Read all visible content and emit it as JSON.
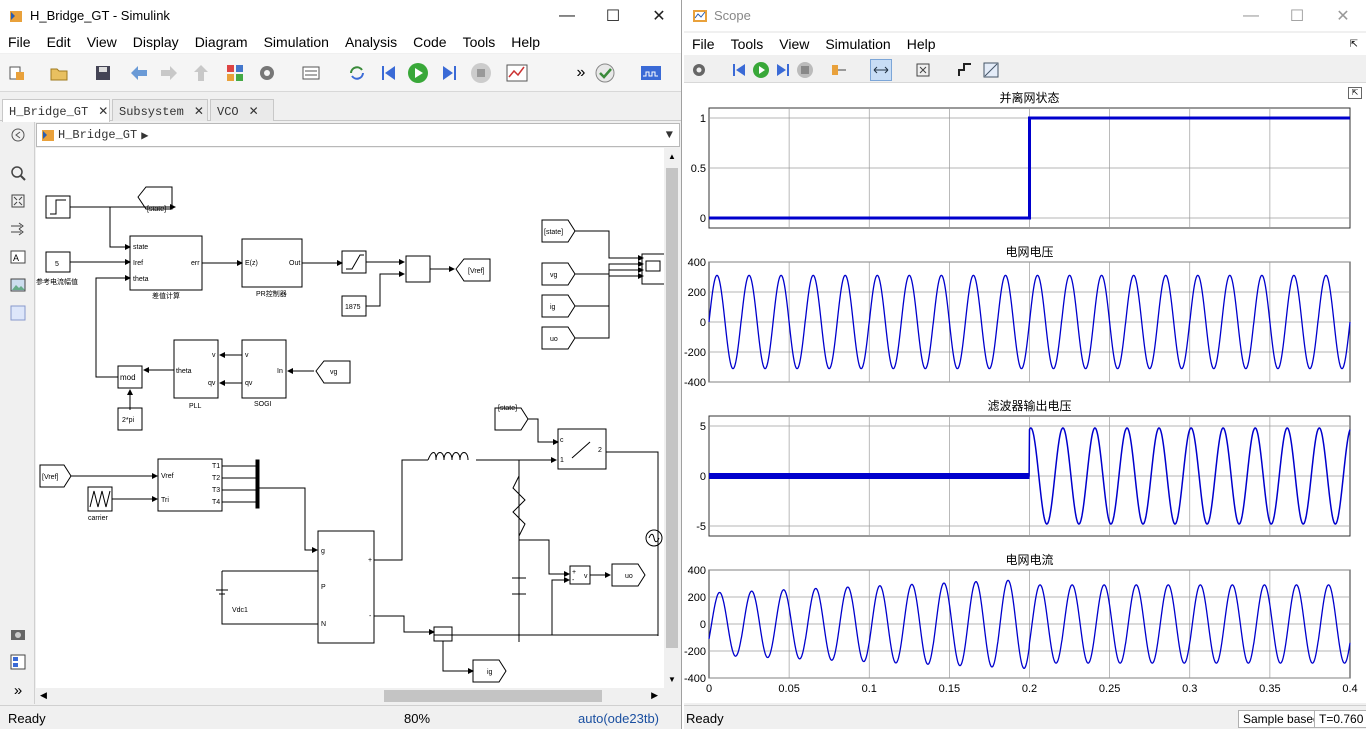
{
  "simulink": {
    "title": "H_Bridge_GT - Simulink",
    "menus": [
      "File",
      "Edit",
      "View",
      "Display",
      "Diagram",
      "Simulation",
      "Analysis",
      "Code",
      "Tools",
      "Help"
    ],
    "tabs": [
      {
        "label": "H_Bridge_GT"
      },
      {
        "label": "Subsystem"
      },
      {
        "label": "VCO"
      }
    ],
    "close_glyph": "✕",
    "breadcrumb": "H_Bridge_GT",
    "status": {
      "left": "Ready",
      "zoom": "80%",
      "solver": "auto(ode23tb)"
    },
    "blocks": {
      "state_tag": "[state]",
      "const5": "5",
      "const5_label": "参考电流幅值",
      "errcalc_label": "差值计算",
      "errcalc_in1": "state",
      "errcalc_in2": "Iref",
      "errcalc_in3": "theta",
      "errcalc_out": "err",
      "pr_label": "PR控制器",
      "pr_in": "E(z)",
      "pr_out": "Out",
      "const1875": "1875",
      "vref_tag": "[Vref]",
      "mod": "mod",
      "twopi": "2*pi",
      "pll_label": "PLL",
      "pll_out": "theta",
      "pll_in1": "v",
      "pll_in2": "qv",
      "sogi_label": "SOGI",
      "sogi_out1": "v",
      "sogi_out2": "qv",
      "sogi_in": "In",
      "vg_tag": "vg",
      "state_in": "[state]",
      "ig_tag": "ig",
      "uo_tag": "uo",
      "vref_in": "[Vref]",
      "carrier_label": "carrier",
      "pwm_in1": "Vref",
      "pwm_in2": "Tri",
      "pwm_out": [
        "T1",
        "T2",
        "T3",
        "T4"
      ],
      "bridge_g": "g",
      "bridge_p": "P",
      "bridge_n": "N",
      "bridge_plus": "+",
      "bridge_minus": "-",
      "vdc_label": "Vdc1",
      "state_tag2": "[state]",
      "switch_c": "c",
      "switch_1": "1",
      "switch_2": "2",
      "uo_out": "uo",
      "ig_out": "ig",
      "volt_plus": "+",
      "volt_minus": "-",
      "volt_v": "v"
    }
  },
  "scope": {
    "title": "Scope",
    "menus": [
      "File",
      "Tools",
      "View",
      "Simulation",
      "Help"
    ],
    "status": {
      "left": "Ready",
      "mode": "Sample based",
      "time": "T=0.760"
    },
    "colors": {
      "trace": "#0000cd",
      "grid": "#9c9c9c"
    },
    "chart_data": [
      {
        "type": "line",
        "title": "并离网状态",
        "ylim": [
          -0.1,
          1.1
        ],
        "yticks": [
          "1",
          "0.5",
          "0"
        ],
        "yticks_v": [
          1,
          0.5,
          0
        ],
        "series": [
          {
            "x": [
              0,
              0.2,
              0.2,
              0.4
            ],
            "values": [
              0,
              0,
              1,
              1
            ]
          }
        ],
        "grid": true
      },
      {
        "type": "line",
        "title": "电网电压",
        "ylim": [
          -400,
          400
        ],
        "yticks": [
          "400",
          "200",
          "0",
          "-200",
          "-400"
        ],
        "yticks_v": [
          400,
          200,
          0,
          -200,
          -400
        ],
        "series": [
          {
            "waveform": "sine",
            "amplitude": 311,
            "frequency_hz": 50,
            "x_range": [
              0,
              0.4
            ]
          }
        ],
        "grid": true
      },
      {
        "type": "line",
        "title": "滤波器输出电压",
        "ylim": [
          -6,
          6
        ],
        "yticks": [
          "5",
          "0",
          "-5"
        ],
        "yticks_v": [
          5,
          0,
          -5
        ],
        "series": [
          {
            "waveform": "piecewise",
            "segments": [
              {
                "x_range": [
                  0,
                  0.2
                ],
                "amplitude": 0.2,
                "note": "noisy near 0"
              },
              {
                "x_range": [
                  0.2,
                  0.4
                ],
                "amplitude": 4.8,
                "frequency_hz": 50
              }
            ]
          }
        ],
        "grid": true
      },
      {
        "type": "line",
        "title": "电网电流",
        "ylim": [
          -400,
          400
        ],
        "yticks": [
          "400",
          "200",
          "0",
          "-200",
          "-400"
        ],
        "yticks_v": [
          400,
          200,
          0,
          -200,
          -400
        ],
        "xticks": [
          "0",
          "0.05",
          "0.1",
          "0.15",
          "0.2",
          "0.25",
          "0.3",
          "0.35",
          "0.4"
        ],
        "xlim": [
          0,
          0.4
        ],
        "series": [
          {
            "waveform": "sine",
            "frequency_hz": 50,
            "amplitude_start": 230,
            "amplitude_peak": 330,
            "amplitude_after": 290,
            "x_range": [
              0,
              0.4
            ]
          }
        ],
        "grid": true
      }
    ]
  }
}
